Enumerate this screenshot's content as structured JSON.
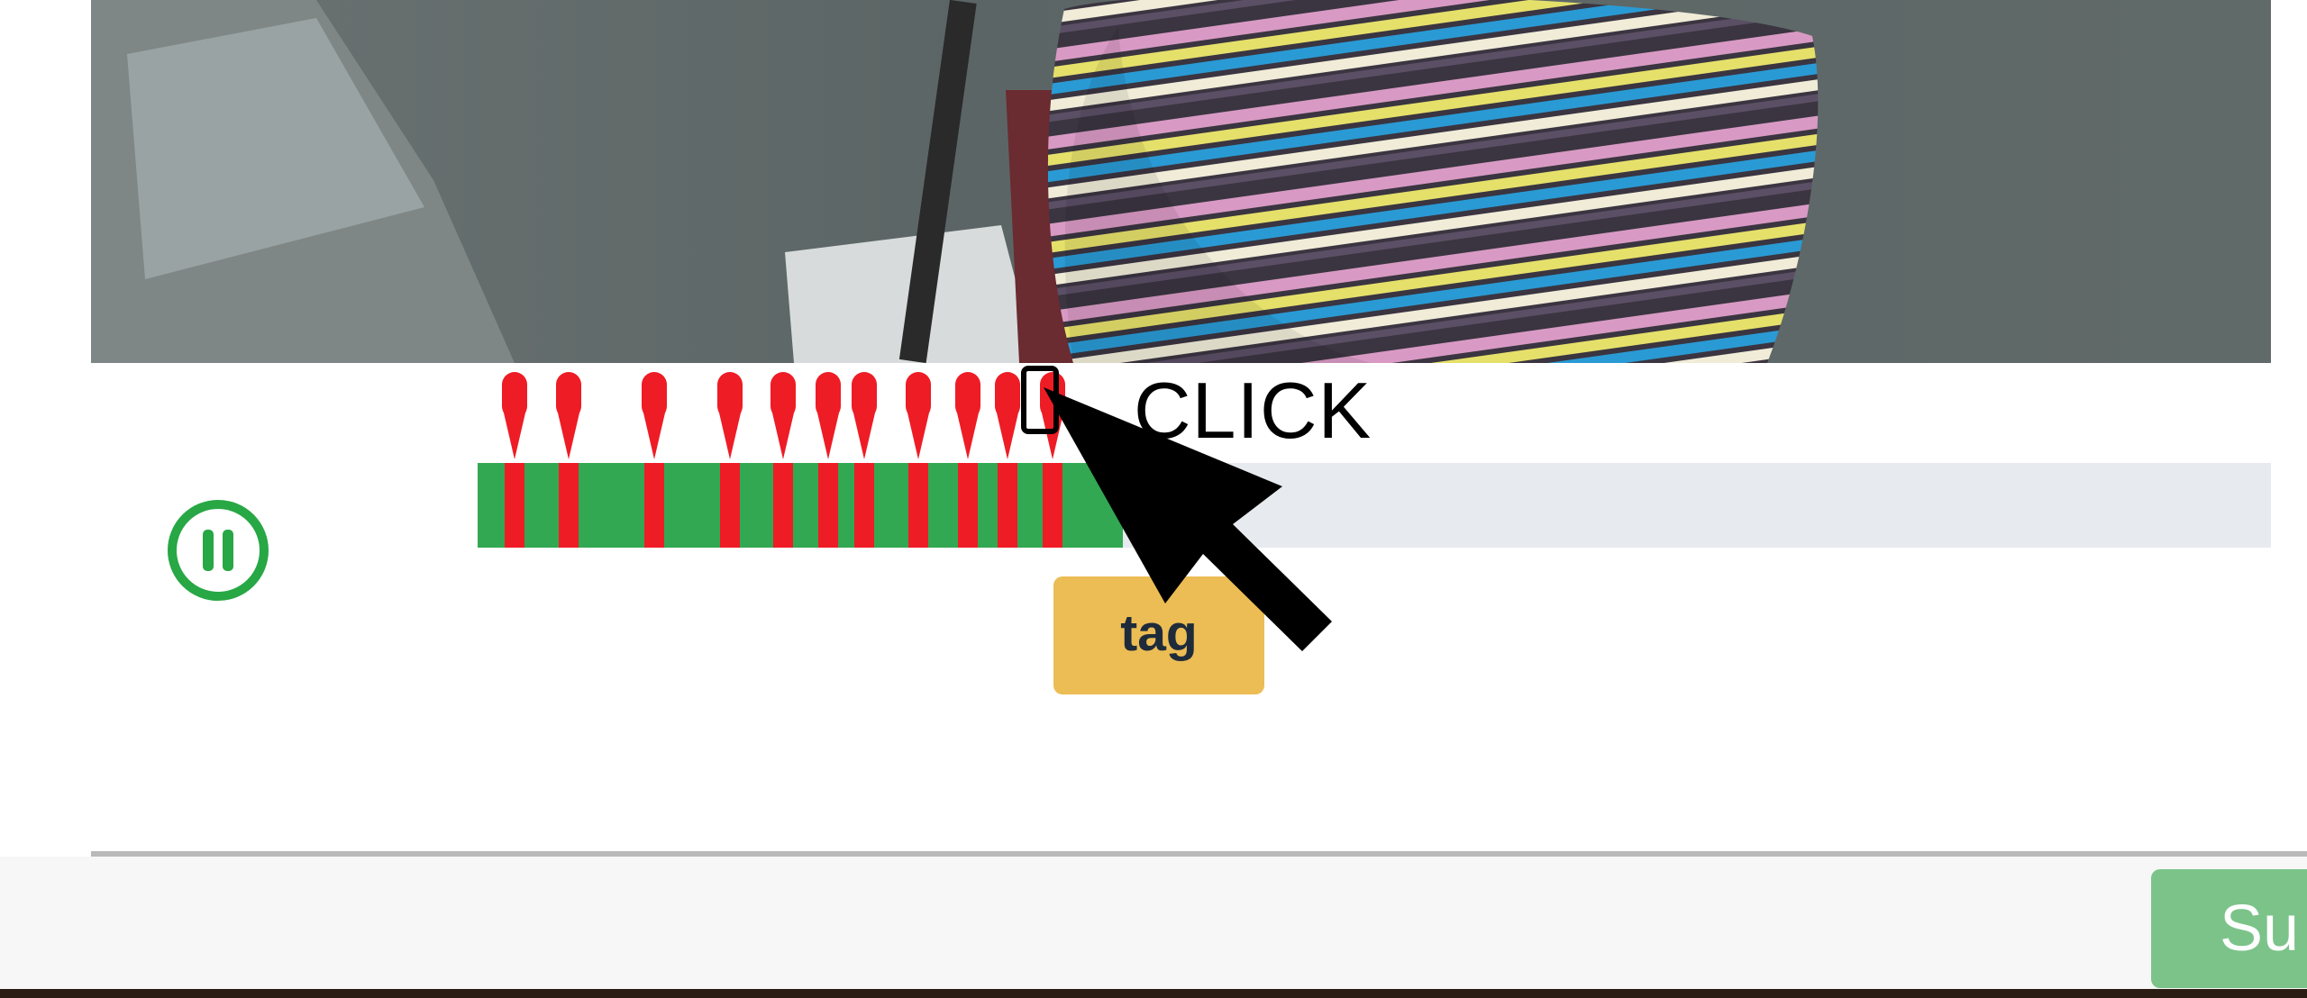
{
  "player": {
    "toggle_icon": "pause-icon",
    "playback_state": "playing",
    "progress_fraction": 0.36
  },
  "timeline": {
    "tag_positions": [
      0.015,
      0.045,
      0.093,
      0.135,
      0.165,
      0.19,
      0.21,
      0.24,
      0.268,
      0.29,
      0.315
    ]
  },
  "tag_button": {
    "label": "tag"
  },
  "annotation": {
    "label": "CLICK",
    "cursor_icon": "arrow-cursor-icon"
  },
  "footer": {
    "submit_label": "Su"
  },
  "colors": {
    "progress": "#33a853",
    "track": "#e7eaee",
    "tag_marker": "#ee1c25",
    "tag_button": "#ecbd55",
    "submit_button": "#7cc38a",
    "pause_icon": "#28a745"
  }
}
